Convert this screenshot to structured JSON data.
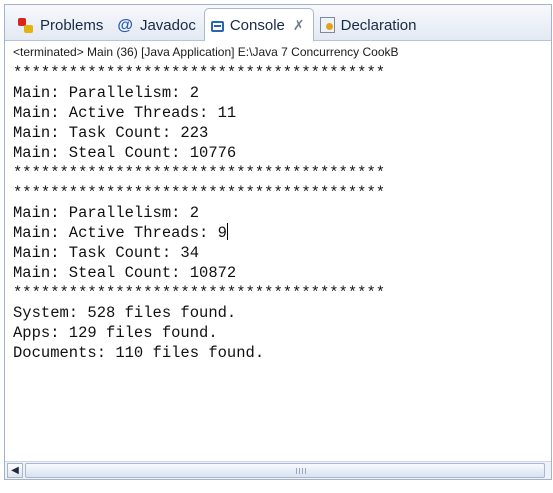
{
  "tabs": [
    {
      "label": "Problems",
      "icon": "problems-icon",
      "active": false
    },
    {
      "label": "Javadoc",
      "icon": "at-icon",
      "glyph": "@",
      "active": false
    },
    {
      "label": "Console",
      "icon": "console-icon",
      "active": true,
      "close_glyph": "✗"
    },
    {
      "label": "Declaration",
      "icon": "declaration-icon",
      "active": false
    }
  ],
  "console": {
    "status": "<terminated> Main (36) [Java Application] E:\\Java 7 Concurrency CookB",
    "lines": [
      "****************************************",
      "Main: Parallelism: 2",
      "Main: Active Threads: 11",
      "Main: Task Count: 223",
      "Main: Steal Count: 10776",
      "****************************************",
      "****************************************",
      "Main: Parallelism: 2",
      "Main: Active Threads: 9",
      "Main: Task Count: 34",
      "Main: Steal Count: 10872",
      "****************************************",
      "System: 528 files found.",
      "Apps: 129 files found.",
      "Documents: 110 files found."
    ]
  },
  "scrollbar": {
    "left_arrow": "◀"
  },
  "colors": {
    "accent": "#2b64b4",
    "tab_border": "#a9b8cf"
  }
}
